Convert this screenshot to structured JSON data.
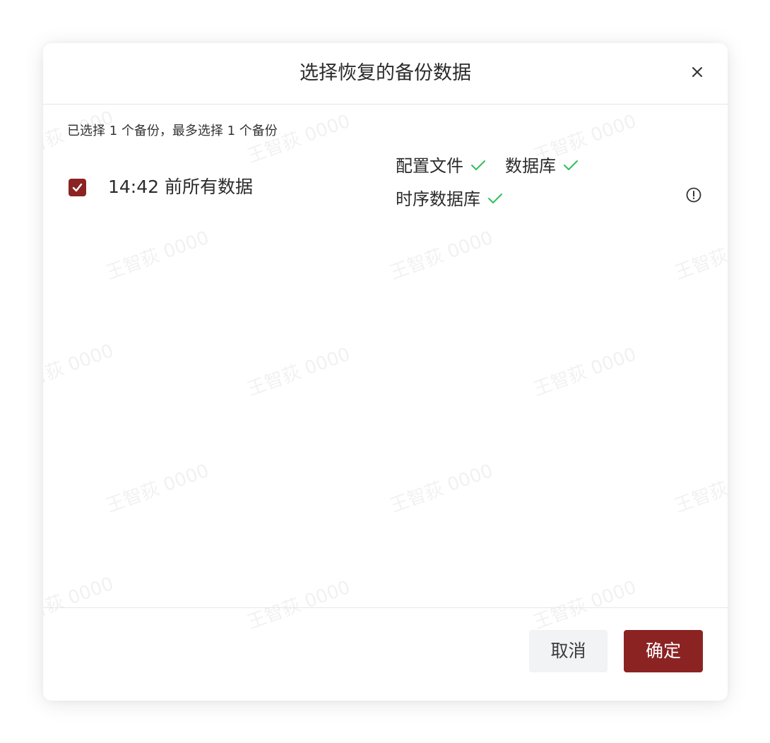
{
  "dialog": {
    "title": "选择恢复的备份数据",
    "close_icon": "close-icon"
  },
  "body": {
    "selection_summary": "已选择 1 个备份，最多选择 1 个备份",
    "backup": {
      "checked": true,
      "label": "14:42 前所有数据",
      "contents": [
        {
          "label": "配置文件",
          "status": "check-icon"
        },
        {
          "label": "数据库",
          "status": "check-icon"
        },
        {
          "label": "时序数据库",
          "status": "check-icon"
        }
      ],
      "info_icon": "info-circle-icon"
    }
  },
  "footer": {
    "cancel_label": "取消",
    "confirm_label": "确定"
  },
  "watermark": "王智荻 0000",
  "colors": {
    "primary": "#8b2323",
    "success": "#2fbf5a",
    "cancel_bg": "#f1f3f5",
    "divider": "#e6e6e6"
  }
}
